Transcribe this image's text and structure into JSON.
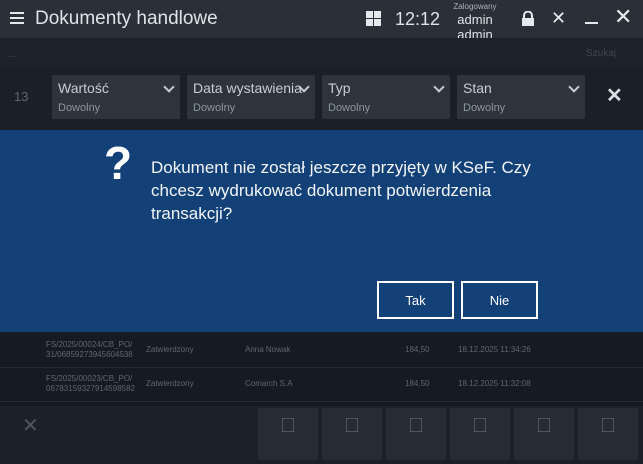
{
  "titlebar": {
    "title": "Dokumenty handlowe",
    "time": "12:12",
    "user_caption": "Zalogowany",
    "user_name": "admin admin",
    "icons": [
      "menu-icon",
      "grid-icon",
      "lock-icon",
      "tools-icon",
      "minimize-icon",
      "close-icon"
    ]
  },
  "search": {
    "left_text": "...",
    "right_text": "Szukaj"
  },
  "filters": {
    "count": "13",
    "items": [
      {
        "label": "Wartość",
        "value": "Dowolny"
      },
      {
        "label": "Data wystawienia",
        "value": "Dowolny"
      },
      {
        "label": "Typ",
        "value": "Dowolny"
      },
      {
        "label": "Stan",
        "value": "Dowolny"
      }
    ]
  },
  "table": {
    "rows": [
      {
        "number": "FS/2025/00024/CB_PO/",
        "ksef": "31/06859273945604538",
        "status": "Zatwierdzony",
        "customer": "Anna Nowak",
        "amount": "184,50",
        "date": "18.12.2025 11:34:26"
      },
      {
        "number": "FS/2025/00023/CB_PO/",
        "ksef": "06783159327914598582",
        "status": "Zatwierdzony",
        "customer": "Comarch S.A",
        "amount": "184,50",
        "date": "18.12.2025 11:32:08"
      }
    ]
  },
  "bottom_bar": {
    "close_label": "Zamknij"
  },
  "dialog": {
    "message": "Dokument nie został jeszcze przyjęty w KSeF. Czy chcesz wydrukować dokument potwierdzenia transakcji?",
    "yes_label": "Tak",
    "no_label": "Nie"
  },
  "colors": {
    "dialog_bg": "#134077",
    "titlebar_bg": "#2a3038",
    "button_border": "#ffffff"
  }
}
